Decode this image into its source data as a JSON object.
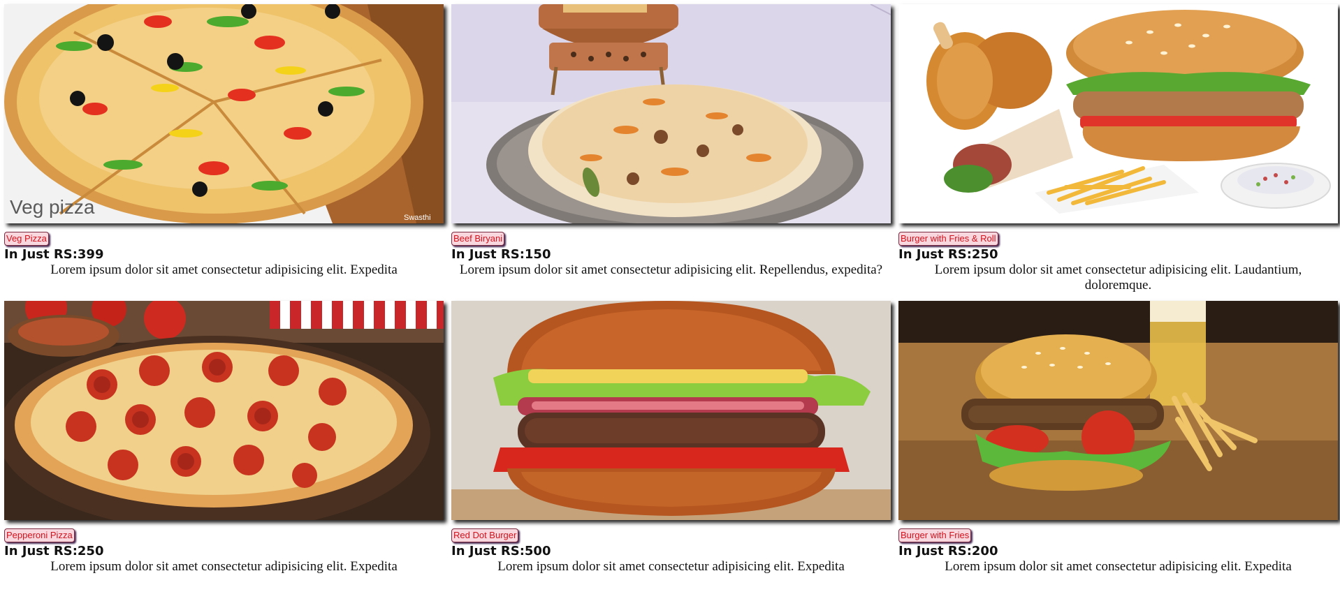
{
  "menu": {
    "items": [
      {
        "name": "Veg Pizza",
        "price": "In Just RS:399",
        "description": "Lorem ipsum dolor sit amet consectetur adipisicing elit. Expedita",
        "image_overlay": "Veg pizza",
        "image_watermark": "Swasthi",
        "icon": "veg-pizza-image"
      },
      {
        "name": "Beef Biryani",
        "price": "In Just RS:150",
        "description": "Lorem ipsum dolor sit amet consectetur adipisicing elit. Repellendus, expedita?",
        "icon": "biryani-image"
      },
      {
        "name": "Burger with Fries & Roll",
        "price": "In Just RS:250",
        "description": "Lorem ipsum dolor sit amet consectetur adipisicing elit. Laudantium, doloremque.",
        "icon": "burger-combo-image"
      },
      {
        "name": "Pepperoni Pizza",
        "price": "In Just RS:250",
        "description": "Lorem ipsum dolor sit amet consectetur adipisicing elit. Expedita",
        "icon": "pepperoni-pizza-image"
      },
      {
        "name": "Red Dot Burger",
        "price": "In Just RS:500",
        "description": "Lorem ipsum dolor sit amet consectetur adipisicing elit. Expedita",
        "icon": "burger-image"
      },
      {
        "name": "Burger with Fries",
        "price": "In Just RS:200",
        "description": "Lorem ipsum dolor sit amet consectetur adipisicing elit. Expedita",
        "icon": "burger-fries-image"
      }
    ]
  },
  "colors": {
    "badge_text": "#d2121c",
    "badge_bg": "#f9d7de",
    "badge_border": "#7b2a42",
    "text": "#111111"
  }
}
